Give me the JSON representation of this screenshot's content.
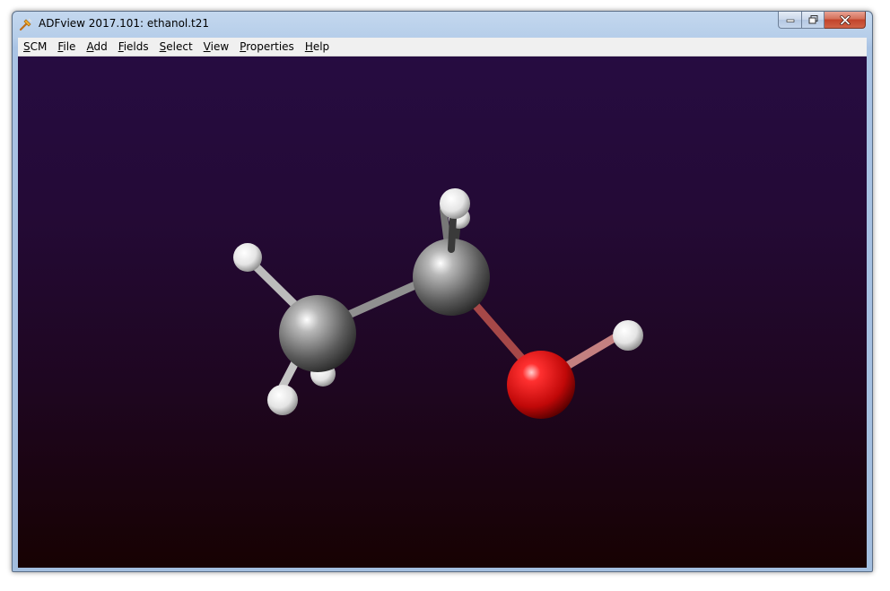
{
  "window": {
    "title": "ADFview 2017.101: ethanol.t21",
    "app_icon": "scm-adf-icon",
    "controls": {
      "minimize_icon": "minimize-icon",
      "maximize_icon": "maximize-icon",
      "close_icon": "close-icon"
    }
  },
  "menubar": {
    "items": [
      {
        "id": "scm",
        "mnemonic": "S",
        "rest": "CM"
      },
      {
        "id": "file",
        "mnemonic": "F",
        "rest": "ile"
      },
      {
        "id": "add",
        "mnemonic": "A",
        "rest": "dd"
      },
      {
        "id": "fields",
        "mnemonic": "F",
        "rest": "ields"
      },
      {
        "id": "select",
        "mnemonic": "S",
        "rest": "elect"
      },
      {
        "id": "view",
        "mnemonic": "V",
        "rest": "iew"
      },
      {
        "id": "properties",
        "mnemonic": "P",
        "rest": "roperties"
      },
      {
        "id": "help",
        "mnemonic": "H",
        "rest": "elp"
      }
    ]
  },
  "viewer": {
    "background_top": "#260c41",
    "background_bottom": "#170202",
    "atom_colors": {
      "C": "#8a8a8a",
      "H": "#f2f2f2",
      "O": "#e41a1a"
    },
    "molecule": "ethanol",
    "atoms": [
      {
        "id": "H6",
        "element": "H"
      },
      {
        "id": "H5",
        "element": "H"
      },
      {
        "id": "H1",
        "element": "H"
      },
      {
        "id": "C2",
        "element": "C"
      },
      {
        "id": "C1",
        "element": "C"
      },
      {
        "id": "O1",
        "element": "O"
      },
      {
        "id": "H9",
        "element": "H"
      },
      {
        "id": "H4",
        "element": "H"
      },
      {
        "id": "H3",
        "element": "H"
      }
    ]
  }
}
